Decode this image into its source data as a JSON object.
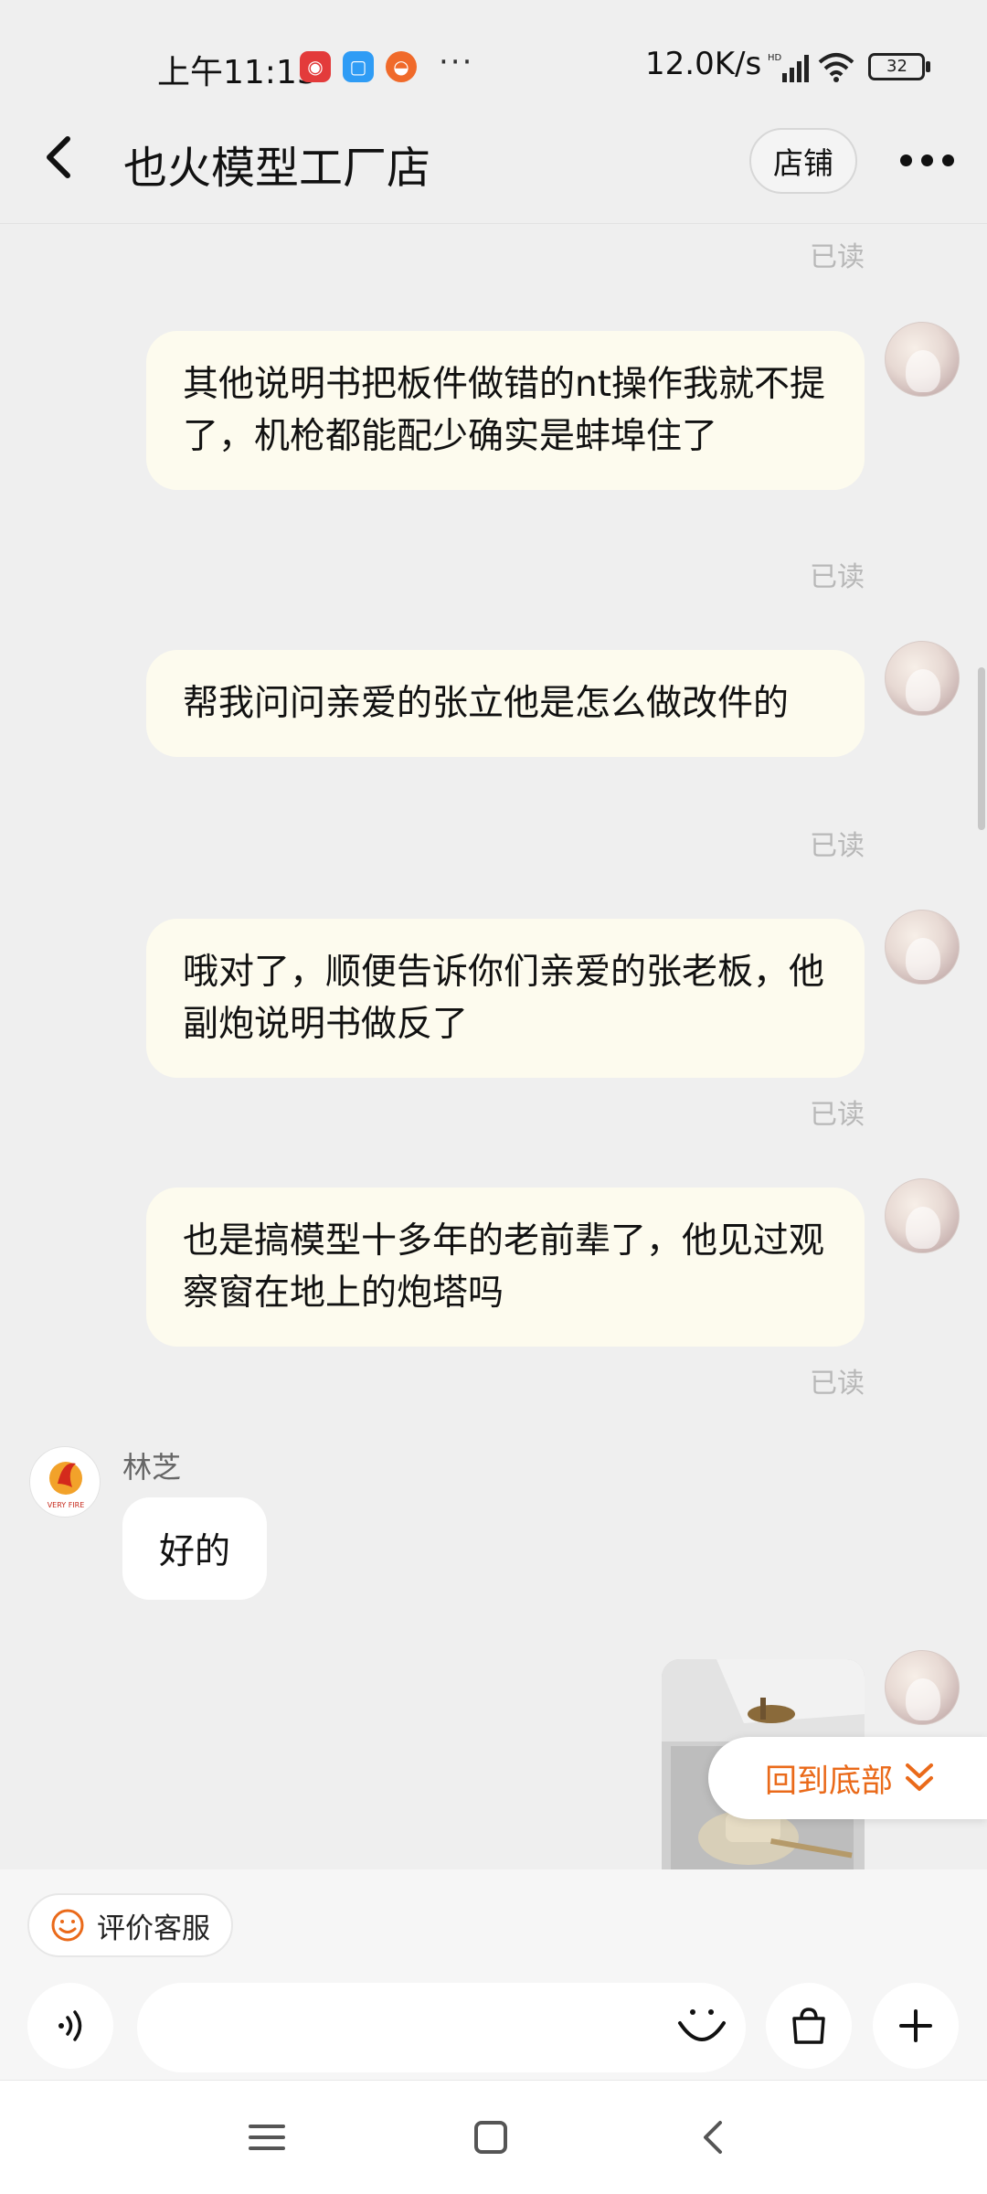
{
  "status_bar": {
    "time": "上午11:13",
    "more": "···",
    "network_speed": "12.0K/s",
    "battery_level": "32"
  },
  "header": {
    "title": "也火模型工厂店",
    "store_button": "店铺"
  },
  "messages": {
    "read_label": "已读",
    "outgoing": [
      "其他说明书把板件做错的nt操作我就不提了，机枪都能配少确实是蚌埠住了",
      "帮我问问亲爱的张立他是怎么做改件的",
      "哦对了，顺便告诉你们亲爱的张老板，他副炮说明书做反了",
      "也是搞模型十多年的老前辈了，他见过观察窗在地上的炮塔吗"
    ],
    "incoming": {
      "sender": "林芝",
      "text": "好的",
      "avatar_caption": "VERY FIRE"
    }
  },
  "scroll_button": {
    "label": "回到底部"
  },
  "bottom": {
    "rate_button": "评价客服",
    "input_placeholder": ""
  },
  "colors": {
    "accent": "#ea6a1a",
    "bubble_out": "#fdfbee",
    "background": "#efefef"
  }
}
